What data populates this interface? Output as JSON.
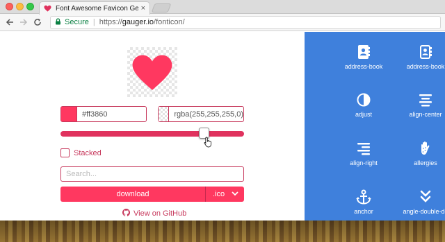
{
  "browser": {
    "tab_title": "Font Awesome Favicon Genera",
    "tab_close": "×",
    "secure_label": "Secure",
    "url_protocol": "https://",
    "url_host": "gauger.io",
    "url_path": "/fonticon/"
  },
  "generator": {
    "foreground_color": "#ff3860",
    "background_color": "rgba(255,255,255,0)",
    "size_level_fraction": 0.8,
    "stacked_label": "Stacked",
    "search_placeholder": "Search...",
    "download_label": "download",
    "format_value": ".ico",
    "github_label": "View on GitHub"
  },
  "icon_panel": {
    "background": "#3f80dc",
    "icons": [
      {
        "icon": "address-book-icon",
        "label": "address-book"
      },
      {
        "icon": "address-book-outline-icon",
        "label": "address-book"
      },
      {
        "icon": "adjust-icon",
        "label": "adjust"
      },
      {
        "icon": "align-center-icon",
        "label": "align-center"
      },
      {
        "icon": "align-right-icon",
        "label": "align-right"
      },
      {
        "icon": "allergies-icon",
        "label": "allergies"
      },
      {
        "icon": "anchor-icon",
        "label": "anchor"
      },
      {
        "icon": "angle-double-down-icon",
        "label": "angle-double-do"
      }
    ]
  },
  "colors": {
    "accent": "#ff3860",
    "accent_dark": "#c7385c",
    "panel": "#3f80dc"
  }
}
